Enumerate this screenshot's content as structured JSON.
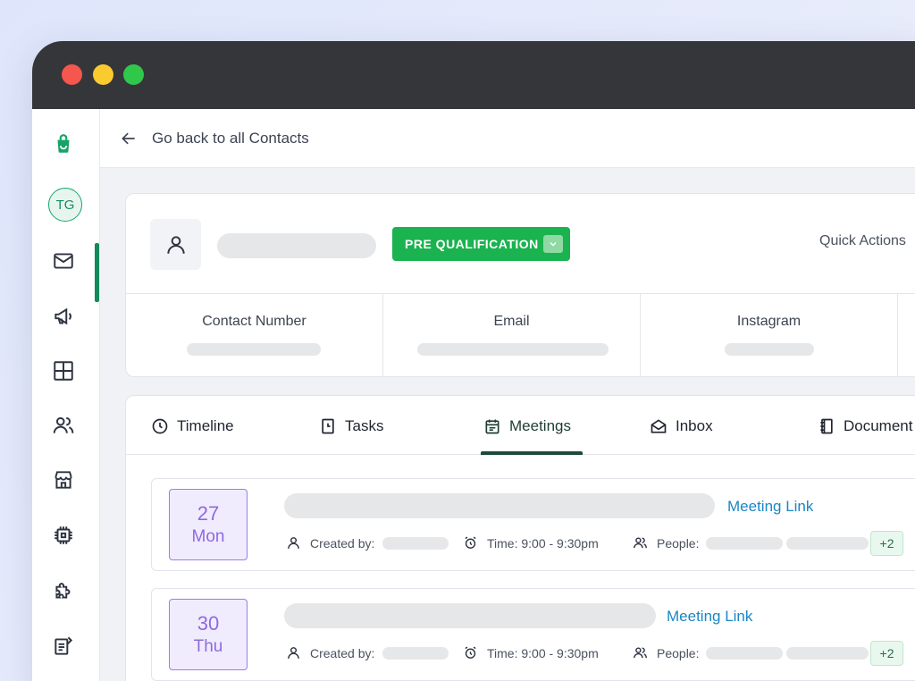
{
  "window": {
    "controls": [
      "close",
      "minimize",
      "maximize"
    ]
  },
  "sidebar": {
    "items": [
      {
        "name": "app-logo",
        "icon": "shopping-bag-icon"
      },
      {
        "name": "avatar",
        "label": "TG"
      },
      {
        "name": "inbox",
        "icon": "mail-icon"
      },
      {
        "name": "campaigns",
        "icon": "megaphone-icon"
      },
      {
        "name": "dashboard",
        "icon": "grid-icon"
      },
      {
        "name": "contacts",
        "icon": "users-icon"
      },
      {
        "name": "store",
        "icon": "store-icon"
      },
      {
        "name": "integrations",
        "icon": "chip-icon"
      },
      {
        "name": "plugins",
        "icon": "puzzle-icon"
      },
      {
        "name": "forms",
        "icon": "edit-doc-icon"
      }
    ],
    "avatar_initials": "TG"
  },
  "topbar": {
    "back_label": "Go back to all Contacts"
  },
  "contact": {
    "stage": "PRE QUALIFICATION",
    "quick_actions": "Quick Actions",
    "fields": [
      {
        "label": "Contact Number"
      },
      {
        "label": "Email"
      },
      {
        "label": "Instagram"
      }
    ]
  },
  "tabs": [
    {
      "label": "Timeline",
      "icon": "clock-icon"
    },
    {
      "label": "Tasks",
      "icon": "task-icon"
    },
    {
      "label": "Meetings",
      "icon": "calendar-icon",
      "active": true
    },
    {
      "label": "Inbox",
      "icon": "envelope-open-icon"
    },
    {
      "label": "Document",
      "icon": "notebook-icon"
    }
  ],
  "meetings": [
    {
      "day": "27",
      "weekday": "Mon",
      "link_label": "Meeting Link",
      "created_by_label": "Created by:",
      "time_label": "Time: 9:00 - 9:30pm",
      "people_label": "People:",
      "more_people": "+2"
    },
    {
      "day": "30",
      "weekday": "Thu",
      "link_label": "Meeting Link",
      "created_by_label": "Created by:",
      "time_label": "Time: 9:00 - 9:30pm",
      "people_label": "People:",
      "more_people": "+2"
    }
  ],
  "colors": {
    "stage_green": "#1ab34f",
    "accent_dark_green": "#1c4a3b",
    "date_purple": "#8e6ae0",
    "link_blue": "#1a87c4"
  }
}
